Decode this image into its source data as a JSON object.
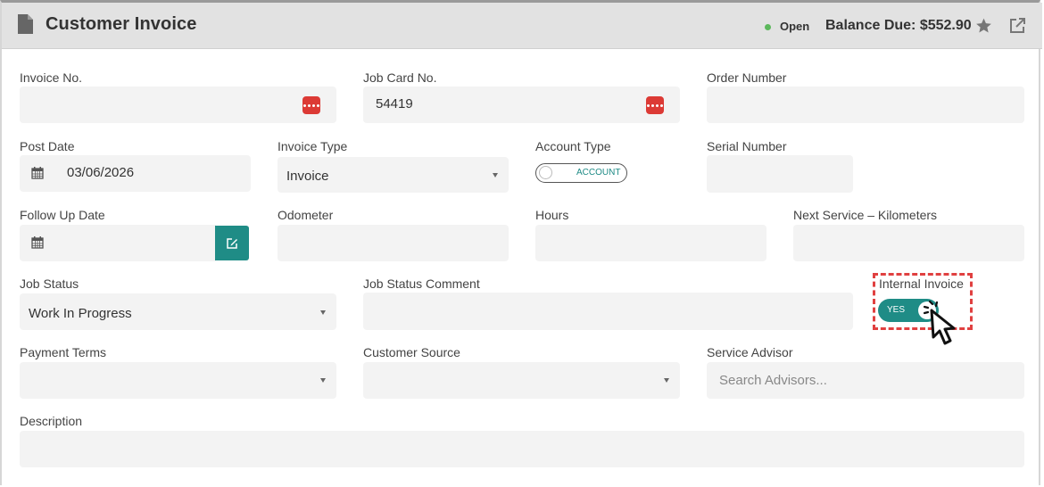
{
  "header": {
    "title": "Customer Invoice",
    "status": "Open",
    "balance": "Balance Due: $552.90",
    "status_color": "#5cb85c"
  },
  "fields": {
    "invoice_no": {
      "label": "Invoice No.",
      "value": ""
    },
    "job_card_no": {
      "label": "Job Card No.",
      "value": "54419"
    },
    "order_number": {
      "label": "Order Number",
      "value": ""
    },
    "post_date": {
      "label": "Post Date",
      "value": "03/06/2026"
    },
    "invoice_type": {
      "label": "Invoice Type",
      "value": "Invoice"
    },
    "account_type": {
      "label": "Account Type",
      "toggle_label": "ACCOUNT"
    },
    "serial_number": {
      "label": "Serial Number",
      "value": ""
    },
    "follow_up_date": {
      "label": "Follow Up Date",
      "value": ""
    },
    "odometer": {
      "label": "Odometer",
      "value": ""
    },
    "hours": {
      "label": "Hours",
      "value": ""
    },
    "next_service_km": {
      "label": "Next Service – Kilometers",
      "value": ""
    },
    "job_status": {
      "label": "Job Status",
      "value": "Work In Progress"
    },
    "job_status_comment": {
      "label": "Job Status Comment",
      "value": ""
    },
    "internal_invoice": {
      "label": "Internal Invoice",
      "toggle_label": "YES"
    },
    "payment_terms": {
      "label": "Payment Terms",
      "value": ""
    },
    "customer_source": {
      "label": "Customer Source",
      "value": ""
    },
    "service_advisor": {
      "label": "Service Advisor",
      "placeholder": "Search Advisors..."
    },
    "description": {
      "label": "Description",
      "value": ""
    }
  },
  "colors": {
    "accent": "#1f8c86",
    "lookup": "#dc3a35",
    "highlight": "#e04040"
  }
}
